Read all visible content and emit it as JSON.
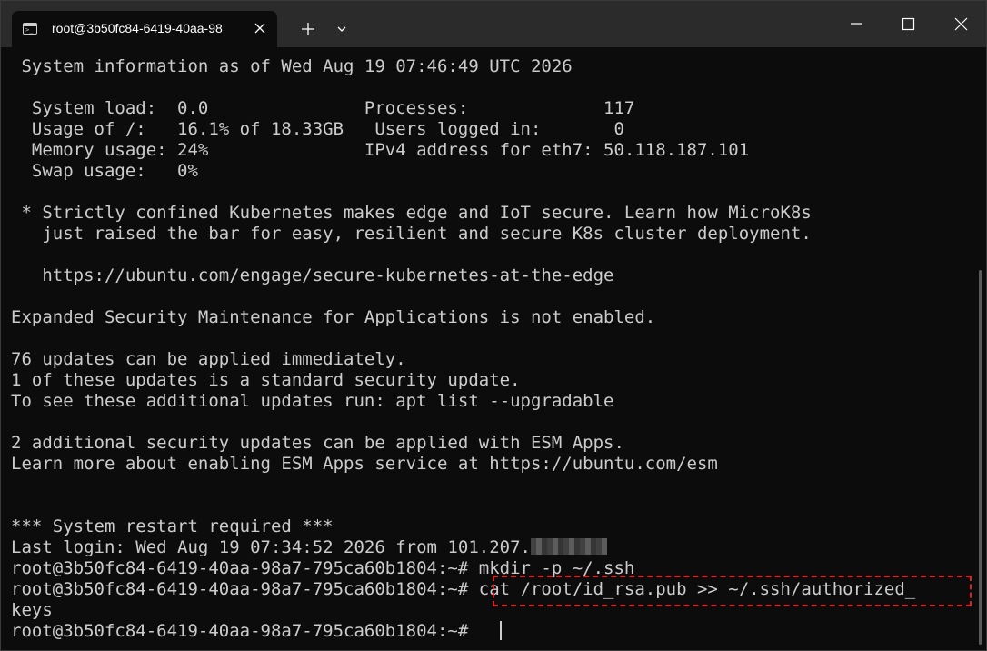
{
  "titlebar": {
    "tab_title": "root@3b50fc84-6419-40aa-98",
    "icons": {
      "terminal": "terminal-icon",
      "close_tab": "close-icon",
      "new_tab": "plus-icon",
      "dropdown": "chevron-down-icon",
      "minimize": "minimize-icon",
      "maximize": "maximize-icon",
      "close_window": "close-icon"
    }
  },
  "terminal": {
    "lines": [
      " System information as of Wed Aug 19 07:46:49 UTC 2026",
      "",
      "  System load:  0.0               Processes:             117",
      "  Usage of /:   16.1% of 18.33GB   Users logged in:       0",
      "  Memory usage: 24%               IPv4 address for eth7: 50.118.187.101",
      "  Swap usage:   0%",
      "",
      " * Strictly confined Kubernetes makes edge and IoT secure. Learn how MicroK8s",
      "   just raised the bar for easy, resilient and secure K8s cluster deployment.",
      "",
      "   https://ubuntu.com/engage/secure-kubernetes-at-the-edge",
      "",
      "Expanded Security Maintenance for Applications is not enabled.",
      "",
      "76 updates can be applied immediately.",
      "1 of these updates is a standard security update.",
      "To see these additional updates run: apt list --upgradable",
      "",
      "2 additional security updates can be applied with ESM Apps.",
      "Learn more about enabling ESM Apps service at https://ubuntu.com/esm",
      "",
      "",
      "*** System restart required ***"
    ],
    "last_login": "Last login: Wed Aug 19 07:34:52 2026 from 101.207.",
    "prompt": "root@3b50fc84-6419-40aa-98a7-795ca60b1804:~# ",
    "cmd1": "mkdir -p ~/.ssh",
    "cmd2": "cat /root/id_rsa.pub >> ~/.ssh/authorized_",
    "cmd2_wrap": "keys",
    "highlight_color": "#e02020",
    "text_color": "#cccccc",
    "background": "#0c0c0c"
  }
}
